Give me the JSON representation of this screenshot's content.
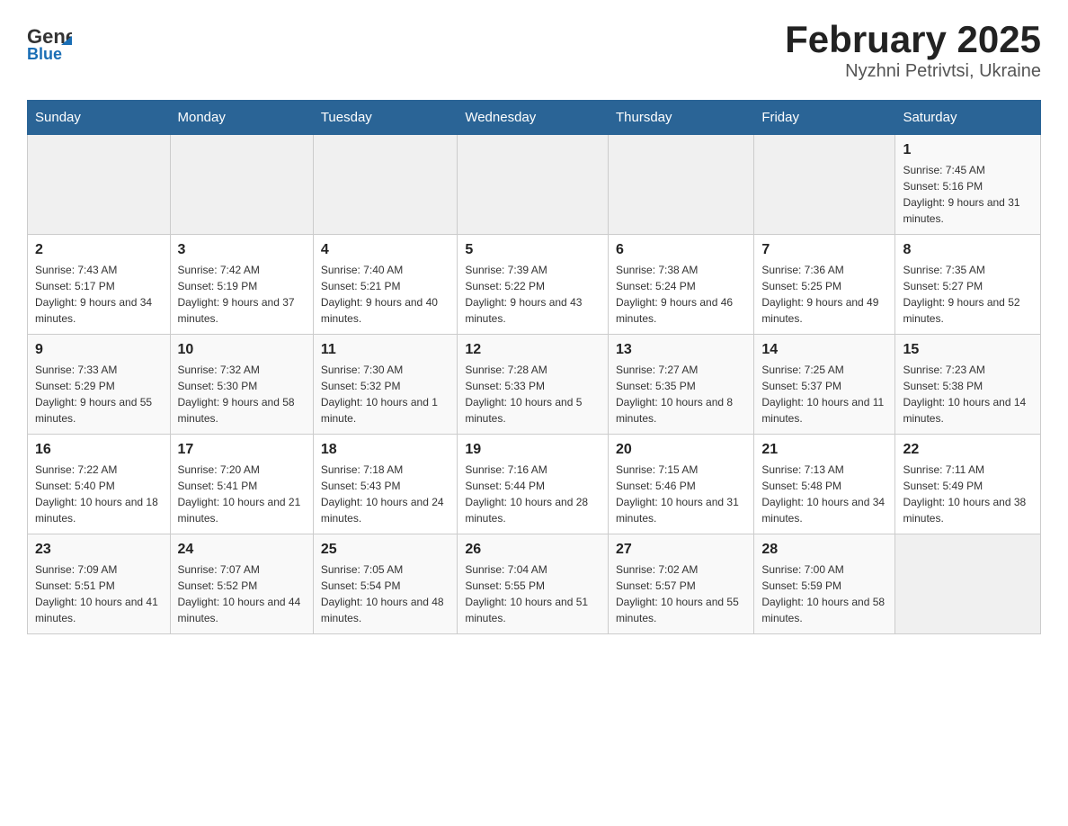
{
  "header": {
    "logo_general": "General",
    "logo_blue": "Blue",
    "month_title": "February 2025",
    "location": "Nyzhni Petrivtsi, Ukraine"
  },
  "days_of_week": [
    "Sunday",
    "Monday",
    "Tuesday",
    "Wednesday",
    "Thursday",
    "Friday",
    "Saturday"
  ],
  "weeks": [
    [
      {
        "day": "",
        "info": ""
      },
      {
        "day": "",
        "info": ""
      },
      {
        "day": "",
        "info": ""
      },
      {
        "day": "",
        "info": ""
      },
      {
        "day": "",
        "info": ""
      },
      {
        "day": "",
        "info": ""
      },
      {
        "day": "1",
        "info": "Sunrise: 7:45 AM\nSunset: 5:16 PM\nDaylight: 9 hours and 31 minutes."
      }
    ],
    [
      {
        "day": "2",
        "info": "Sunrise: 7:43 AM\nSunset: 5:17 PM\nDaylight: 9 hours and 34 minutes."
      },
      {
        "day": "3",
        "info": "Sunrise: 7:42 AM\nSunset: 5:19 PM\nDaylight: 9 hours and 37 minutes."
      },
      {
        "day": "4",
        "info": "Sunrise: 7:40 AM\nSunset: 5:21 PM\nDaylight: 9 hours and 40 minutes."
      },
      {
        "day": "5",
        "info": "Sunrise: 7:39 AM\nSunset: 5:22 PM\nDaylight: 9 hours and 43 minutes."
      },
      {
        "day": "6",
        "info": "Sunrise: 7:38 AM\nSunset: 5:24 PM\nDaylight: 9 hours and 46 minutes."
      },
      {
        "day": "7",
        "info": "Sunrise: 7:36 AM\nSunset: 5:25 PM\nDaylight: 9 hours and 49 minutes."
      },
      {
        "day": "8",
        "info": "Sunrise: 7:35 AM\nSunset: 5:27 PM\nDaylight: 9 hours and 52 minutes."
      }
    ],
    [
      {
        "day": "9",
        "info": "Sunrise: 7:33 AM\nSunset: 5:29 PM\nDaylight: 9 hours and 55 minutes."
      },
      {
        "day": "10",
        "info": "Sunrise: 7:32 AM\nSunset: 5:30 PM\nDaylight: 9 hours and 58 minutes."
      },
      {
        "day": "11",
        "info": "Sunrise: 7:30 AM\nSunset: 5:32 PM\nDaylight: 10 hours and 1 minute."
      },
      {
        "day": "12",
        "info": "Sunrise: 7:28 AM\nSunset: 5:33 PM\nDaylight: 10 hours and 5 minutes."
      },
      {
        "day": "13",
        "info": "Sunrise: 7:27 AM\nSunset: 5:35 PM\nDaylight: 10 hours and 8 minutes."
      },
      {
        "day": "14",
        "info": "Sunrise: 7:25 AM\nSunset: 5:37 PM\nDaylight: 10 hours and 11 minutes."
      },
      {
        "day": "15",
        "info": "Sunrise: 7:23 AM\nSunset: 5:38 PM\nDaylight: 10 hours and 14 minutes."
      }
    ],
    [
      {
        "day": "16",
        "info": "Sunrise: 7:22 AM\nSunset: 5:40 PM\nDaylight: 10 hours and 18 minutes."
      },
      {
        "day": "17",
        "info": "Sunrise: 7:20 AM\nSunset: 5:41 PM\nDaylight: 10 hours and 21 minutes."
      },
      {
        "day": "18",
        "info": "Sunrise: 7:18 AM\nSunset: 5:43 PM\nDaylight: 10 hours and 24 minutes."
      },
      {
        "day": "19",
        "info": "Sunrise: 7:16 AM\nSunset: 5:44 PM\nDaylight: 10 hours and 28 minutes."
      },
      {
        "day": "20",
        "info": "Sunrise: 7:15 AM\nSunset: 5:46 PM\nDaylight: 10 hours and 31 minutes."
      },
      {
        "day": "21",
        "info": "Sunrise: 7:13 AM\nSunset: 5:48 PM\nDaylight: 10 hours and 34 minutes."
      },
      {
        "day": "22",
        "info": "Sunrise: 7:11 AM\nSunset: 5:49 PM\nDaylight: 10 hours and 38 minutes."
      }
    ],
    [
      {
        "day": "23",
        "info": "Sunrise: 7:09 AM\nSunset: 5:51 PM\nDaylight: 10 hours and 41 minutes."
      },
      {
        "day": "24",
        "info": "Sunrise: 7:07 AM\nSunset: 5:52 PM\nDaylight: 10 hours and 44 minutes."
      },
      {
        "day": "25",
        "info": "Sunrise: 7:05 AM\nSunset: 5:54 PM\nDaylight: 10 hours and 48 minutes."
      },
      {
        "day": "26",
        "info": "Sunrise: 7:04 AM\nSunset: 5:55 PM\nDaylight: 10 hours and 51 minutes."
      },
      {
        "day": "27",
        "info": "Sunrise: 7:02 AM\nSunset: 5:57 PM\nDaylight: 10 hours and 55 minutes."
      },
      {
        "day": "28",
        "info": "Sunrise: 7:00 AM\nSunset: 5:59 PM\nDaylight: 10 hours and 58 minutes."
      },
      {
        "day": "",
        "info": ""
      }
    ]
  ]
}
